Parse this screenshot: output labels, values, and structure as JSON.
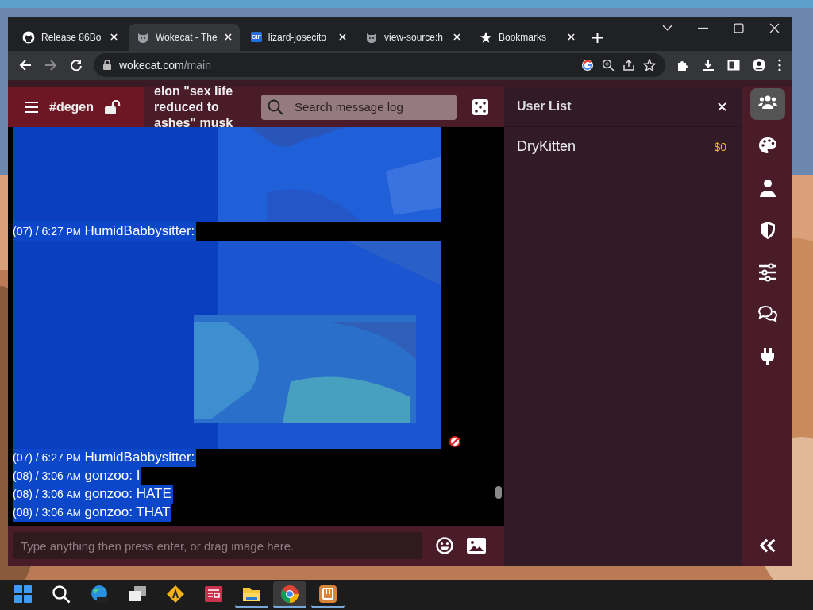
{
  "browser": {
    "tabs": [
      {
        "title": "Release 86Bo",
        "kind": "github",
        "selected": false
      },
      {
        "title": "Wokecat - The",
        "kind": "cat",
        "selected": true
      },
      {
        "title": "lizard-josecito",
        "kind": "gif",
        "badge": "GIF",
        "selected": false
      },
      {
        "title": "view-source:h",
        "kind": "cat",
        "selected": false
      },
      {
        "title": "Bookmarks",
        "kind": "star",
        "selected": false
      }
    ],
    "url_host": "wokecat.com",
    "url_path": "/main"
  },
  "header": {
    "channel": "#degen",
    "locked": false,
    "topic": "elon \"sex life reduced to ashes\" musk",
    "search_placeholder": "Search message log"
  },
  "messages": [
    {
      "kind": "picture"
    },
    {
      "kind": "message",
      "date": "(07) /",
      "time": "6:27",
      "meridiem": "PM",
      "user": "HumidBabbysitter:",
      "selected": true
    },
    {
      "kind": "picture"
    },
    {
      "kind": "message",
      "date": "(07) /",
      "time": "6:27",
      "meridiem": "PM",
      "user": "HumidBabbysitter:",
      "selected": true
    },
    {
      "kind": "message",
      "date": "(08) /",
      "time": "3:06",
      "meridiem": "AM",
      "user": "gonzoo:",
      "text": "I",
      "selected": true
    },
    {
      "kind": "message",
      "date": "(08) /",
      "time": "3:06",
      "meridiem": "AM",
      "user": "gonzoo:",
      "text": "HATE",
      "selected": true
    },
    {
      "kind": "message",
      "date": "(08) /",
      "time": "3:06",
      "meridiem": "AM",
      "user": "gonzoo:",
      "text": "THAT",
      "selected": true
    }
  ],
  "composer": {
    "placeholder": "Type anything then press enter, or drag image here."
  },
  "user_list": {
    "title": "User List",
    "users": [
      {
        "name": "DryKitten",
        "balance": "$0"
      }
    ]
  },
  "rail": [
    {
      "kind": "users",
      "selected": true
    },
    {
      "kind": "palette",
      "selected": false
    },
    {
      "kind": "user",
      "selected": false
    },
    {
      "kind": "shield",
      "selected": false
    },
    {
      "kind": "sliders",
      "selected": false
    },
    {
      "kind": "chat",
      "selected": false
    },
    {
      "kind": "plug",
      "selected": false
    }
  ],
  "taskbar": [
    {
      "kind": "start",
      "open": false
    },
    {
      "kind": "search",
      "open": false
    },
    {
      "kind": "edge",
      "open": false
    },
    {
      "kind": "taskview",
      "open": false
    },
    {
      "kind": "sign",
      "open": false
    },
    {
      "kind": "news",
      "open": false
    },
    {
      "kind": "folder",
      "open": true
    },
    {
      "kind": "chrome",
      "open": true
    },
    {
      "kind": "app",
      "open": true
    }
  ]
}
